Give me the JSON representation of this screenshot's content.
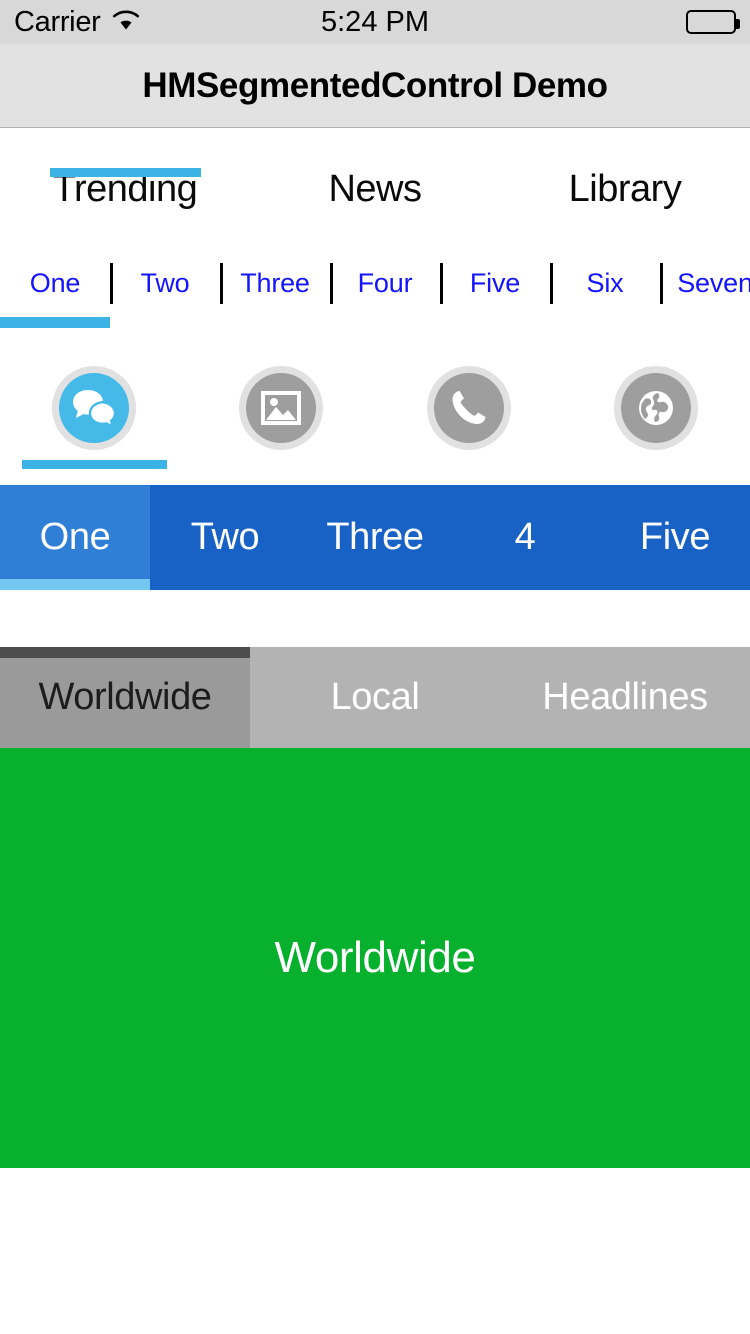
{
  "status_bar": {
    "carrier": "Carrier",
    "wifi_icon": "wifi-icon",
    "time": "5:24 PM",
    "battery_icon": "battery-full-icon"
  },
  "nav_bar": {
    "title": "HMSegmentedControl Demo"
  },
  "segmented_control_1": {
    "name": "text-segments-top-indicator",
    "selected_index": 0,
    "indicator_color": "#3bb3e4",
    "items": [
      {
        "label": "Trending"
      },
      {
        "label": "News"
      },
      {
        "label": "Library"
      }
    ]
  },
  "segmented_control_2": {
    "name": "scrollable-text-segments",
    "selected_index": 0,
    "indicator_color": "#3bb3e4",
    "text_color": "#1414ff",
    "items": [
      {
        "label": "One"
      },
      {
        "label": "Two"
      },
      {
        "label": "Three"
      },
      {
        "label": "Four"
      },
      {
        "label": "Five"
      },
      {
        "label": "Six"
      },
      {
        "label": "Seven"
      }
    ]
  },
  "segmented_control_3": {
    "name": "icon-segments",
    "selected_index": 0,
    "indicator_color": "#3bb3e4",
    "items": [
      {
        "icon": "chat-bubbles-icon",
        "selected": true
      },
      {
        "icon": "photo-icon",
        "selected": false
      },
      {
        "icon": "phone-icon",
        "selected": false
      },
      {
        "icon": "globe-icon",
        "selected": false
      }
    ]
  },
  "segmented_control_4": {
    "name": "blue-box-segments",
    "selected_index": 0,
    "background_color": "#1862c6",
    "selection_color": "#2f7fd6",
    "indicator_color": "#74c7f0",
    "text_color": "#ffffff",
    "items": [
      {
        "label": "One"
      },
      {
        "label": "Two"
      },
      {
        "label": "Three"
      },
      {
        "label": "4"
      },
      {
        "label": "Five"
      }
    ]
  },
  "segmented_control_5": {
    "name": "gray-box-segments",
    "selected_index": 0,
    "background_color": "#b3b3b3",
    "selection_color": "#9a9a9a",
    "indicator_color": "#4d4d4d",
    "items": [
      {
        "label": "Worldwide"
      },
      {
        "label": "Local"
      },
      {
        "label": "Headlines"
      }
    ]
  },
  "content_panel": {
    "label": "Worldwide",
    "background_color": "#07b12e"
  }
}
